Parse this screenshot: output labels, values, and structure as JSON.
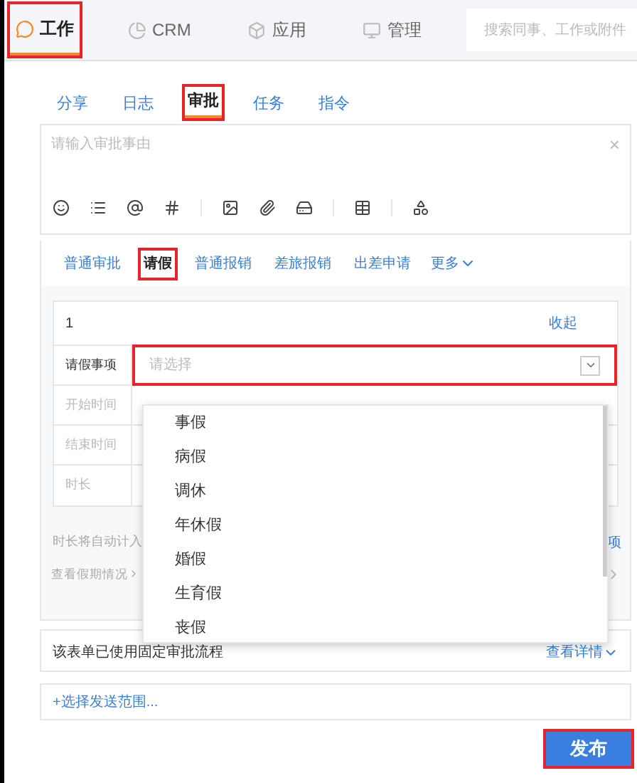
{
  "nav": {
    "items": [
      {
        "label": "工作",
        "selected": true,
        "annotated": true
      },
      {
        "label": "CRM",
        "selected": false,
        "annotated": false
      },
      {
        "label": "应用",
        "selected": false,
        "annotated": false
      },
      {
        "label": "管理",
        "selected": false,
        "annotated": false
      }
    ],
    "search": {
      "placeholder": "搜索同事、工作或附件"
    }
  },
  "post_tabs": [
    {
      "label": "分享",
      "selected": false,
      "annotated": false
    },
    {
      "label": "日志",
      "selected": false,
      "annotated": false
    },
    {
      "label": "审批",
      "selected": true,
      "annotated": true
    },
    {
      "label": "任务",
      "selected": false,
      "annotated": false
    },
    {
      "label": "指令",
      "selected": false,
      "annotated": false
    }
  ],
  "editor": {
    "placeholder": "请输入审批事由",
    "close": "×"
  },
  "approval_tabs": [
    {
      "label": "普通审批",
      "selected": false,
      "annotated": false
    },
    {
      "label": "请假",
      "selected": true,
      "annotated": true
    },
    {
      "label": "普通报销",
      "selected": false,
      "annotated": false
    },
    {
      "label": "差旅报销",
      "selected": false,
      "annotated": false
    },
    {
      "label": "出差申请",
      "selected": false,
      "annotated": false
    }
  ],
  "more": "更多",
  "form": {
    "index": "1",
    "collapse": "收起",
    "fields": [
      {
        "label": "请假事项",
        "placeholder": "请选择",
        "disabled": false
      },
      {
        "label": "开始时间",
        "disabled": true
      },
      {
        "label": "结束时间",
        "disabled": true
      },
      {
        "label": "时长",
        "disabled": true
      }
    ],
    "note": "时长将自动计入",
    "note_right": "项",
    "leave_link": "查看假期情况"
  },
  "dropdown": {
    "options": [
      "事假",
      "病假",
      "调休",
      "年休假",
      "婚假",
      "生育假",
      "丧假"
    ]
  },
  "flow": {
    "text": "该表单已使用固定审批流程",
    "link": "查看详情"
  },
  "scope": "+选择发送范围...",
  "publish": {
    "label": "发布",
    "annotated": true
  }
}
